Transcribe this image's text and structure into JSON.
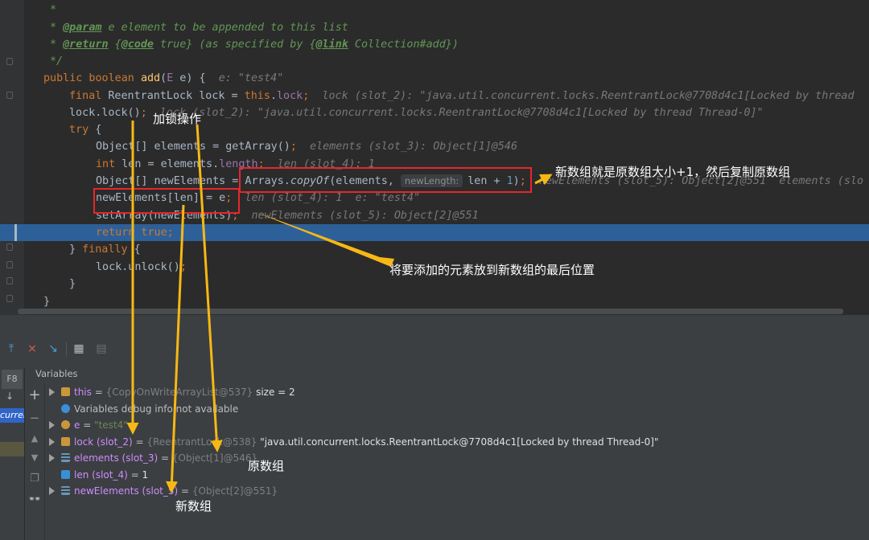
{
  "editor": {
    "lines": [
      {
        "segments": [
          {
            "c": "cmt",
            "v": "*"
          }
        ]
      },
      {
        "segments": [
          {
            "c": "cmt",
            "v": "* "
          },
          {
            "c": "tag",
            "v": "@param"
          },
          {
            "c": "cmt",
            "v": " e element to be appended to this list"
          }
        ]
      },
      {
        "segments": [
          {
            "c": "cmt",
            "v": "* "
          },
          {
            "c": "tag",
            "v": "@return"
          },
          {
            "c": "cmt",
            "v": " {"
          },
          {
            "c": "tag",
            "v": "@code"
          },
          {
            "c": "cmt",
            "v": " true} (as specified by {"
          },
          {
            "c": "tag",
            "v": "@link"
          },
          {
            "c": "cmt",
            "v": " Collection#add})"
          }
        ]
      },
      {
        "segments": [
          {
            "c": "cmt",
            "v": "*/"
          }
        ]
      },
      {
        "segments": [
          {
            "c": "kw",
            "v": "public boolean "
          },
          {
            "c": "fn",
            "v": "add"
          },
          {
            "c": "",
            "v": "("
          },
          {
            "c": "fld",
            "v": "E"
          },
          {
            "c": "",
            "v": " e) {  "
          },
          {
            "c": "dbg",
            "v": "e: \"test4\""
          }
        ]
      },
      {
        "segments": [
          {
            "c": "kw",
            "v": "final "
          },
          {
            "c": "",
            "v": "ReentrantLock lock = "
          },
          {
            "c": "kw",
            "v": "this"
          },
          {
            "c": "",
            "v": "."
          },
          {
            "c": "fld",
            "v": "lock"
          },
          {
            "c": "kw",
            "v": ";"
          },
          {
            "c": "dbg",
            "v": "  lock (slot_2): \"java.util.concurrent.locks.ReentrantLock@7708d4c1[Locked by thread"
          }
        ]
      },
      {
        "segments": [
          {
            "c": "",
            "v": "lock.lock()"
          },
          {
            "c": "kw",
            "v": ";"
          },
          {
            "c": "dbg",
            "v": "  lock (slot_2): \"java.util.concurrent.locks.ReentrantLock@7708d4c1[Locked by thread Thread-0]\""
          }
        ]
      },
      {
        "segments": [
          {
            "c": "kw",
            "v": "try "
          },
          {
            "c": "",
            "v": "{"
          }
        ]
      },
      {
        "segments": [
          {
            "c": "",
            "v": "Object[] elements = getArray()"
          },
          {
            "c": "kw",
            "v": ";"
          },
          {
            "c": "dbg",
            "v": "  elements (slot_3): Object[1]@546"
          }
        ]
      },
      {
        "segments": [
          {
            "c": "kw",
            "v": "int "
          },
          {
            "c": "",
            "v": "len = elements."
          },
          {
            "c": "fld",
            "v": "length"
          },
          {
            "c": "kw",
            "v": ";"
          },
          {
            "c": "dbg",
            "v": "  len (slot_4): 1"
          }
        ]
      },
      {
        "segments": [
          {
            "c": "",
            "v": "Object[] newElements = Arrays."
          },
          {
            "c": "ita",
            "v": "copyOf"
          },
          {
            "c": "",
            "v": "(elements, "
          },
          {
            "c": "hint",
            "v": "newLength:"
          },
          {
            "c": "",
            "v": "len + "
          },
          {
            "c": "num",
            "v": "1"
          },
          {
            "c": "",
            "v": ")"
          },
          {
            "c": "kw",
            "v": ";"
          },
          {
            "c": "dbg",
            "v": "  newElements (slot_5): Object[2]@551  elements (slo"
          }
        ]
      },
      {
        "segments": [
          {
            "c": "",
            "v": "newElements[len] = e"
          },
          {
            "c": "kw",
            "v": ";"
          },
          {
            "c": "dbg",
            "v": "  len (slot_4): 1  e: \"test4\""
          }
        ]
      },
      {
        "segments": [
          {
            "c": "",
            "v": "setArray(newElements)"
          },
          {
            "c": "kw",
            "v": ";"
          },
          {
            "c": "dbg",
            "v": "  newElements (slot_5): Object[2]@551"
          }
        ]
      },
      {
        "segments": [
          {
            "c": "kw",
            "v": "return true;"
          }
        ]
      },
      {
        "segments": [
          {
            "c": "",
            "v": "} "
          },
          {
            "c": "kw",
            "v": "finally "
          },
          {
            "c": "",
            "v": "{"
          }
        ]
      },
      {
        "segments": [
          {
            "c": "",
            "v": "lock.unlock()"
          },
          {
            "c": "kw",
            "v": ";"
          }
        ]
      },
      {
        "segments": [
          {
            "c": "",
            "v": "}"
          }
        ]
      },
      {
        "segments": [
          {
            "c": "",
            "v": "}"
          }
        ]
      }
    ]
  },
  "debugger": {
    "frame_tab": "F8",
    "frame_selected": "current",
    "variables_title": "Variables",
    "variables": [
      {
        "name": "this",
        "eq": " = ",
        "type": "{CopyOnWriteArrayList@537}",
        "value": "  size = 2",
        "icon": "field-icon",
        "expandable": true
      },
      {
        "name": "",
        "eq": "",
        "type": "",
        "value": "Variables debug info not available",
        "icon": "info-icon",
        "expandable": false
      },
      {
        "name": "e",
        "eq": " = ",
        "type": "",
        "value": "\"test4\"",
        "icon": "param-icon",
        "expandable": true
      },
      {
        "name": "lock (slot_2)",
        "eq": " = ",
        "type": "{ReentrantLock@538}",
        "value": " \"java.util.concurrent.locks.ReentrantLock@7708d4c1[Locked by thread Thread-0]\"",
        "icon": "field-icon",
        "expandable": true
      },
      {
        "name": "elements (slot_3)",
        "eq": " = ",
        "type": "{Object[1]@546}",
        "value": "",
        "icon": "array-icon",
        "expandable": true
      },
      {
        "name": "len (slot_4)",
        "eq": " = ",
        "type": "",
        "value": "1",
        "icon": "int-icon",
        "expandable": false
      },
      {
        "name": "newElements (slot_5)",
        "eq": " = ",
        "type": "{Object[2]@551}",
        "value": "",
        "icon": "array-icon",
        "expandable": true
      }
    ]
  },
  "annotations": {
    "lock_op": "加锁操作",
    "new_array_note": "新数组就是原数组大小+1，然后复制原数组",
    "place_last_note": "将要添加的元素放到新数组的最后位置",
    "original_array": "原数组",
    "new_array": "新数组"
  },
  "colors": {
    "annotation_arrow": "#f7b815",
    "box_red": "#e8262b",
    "selection_line": "#2d6099"
  }
}
